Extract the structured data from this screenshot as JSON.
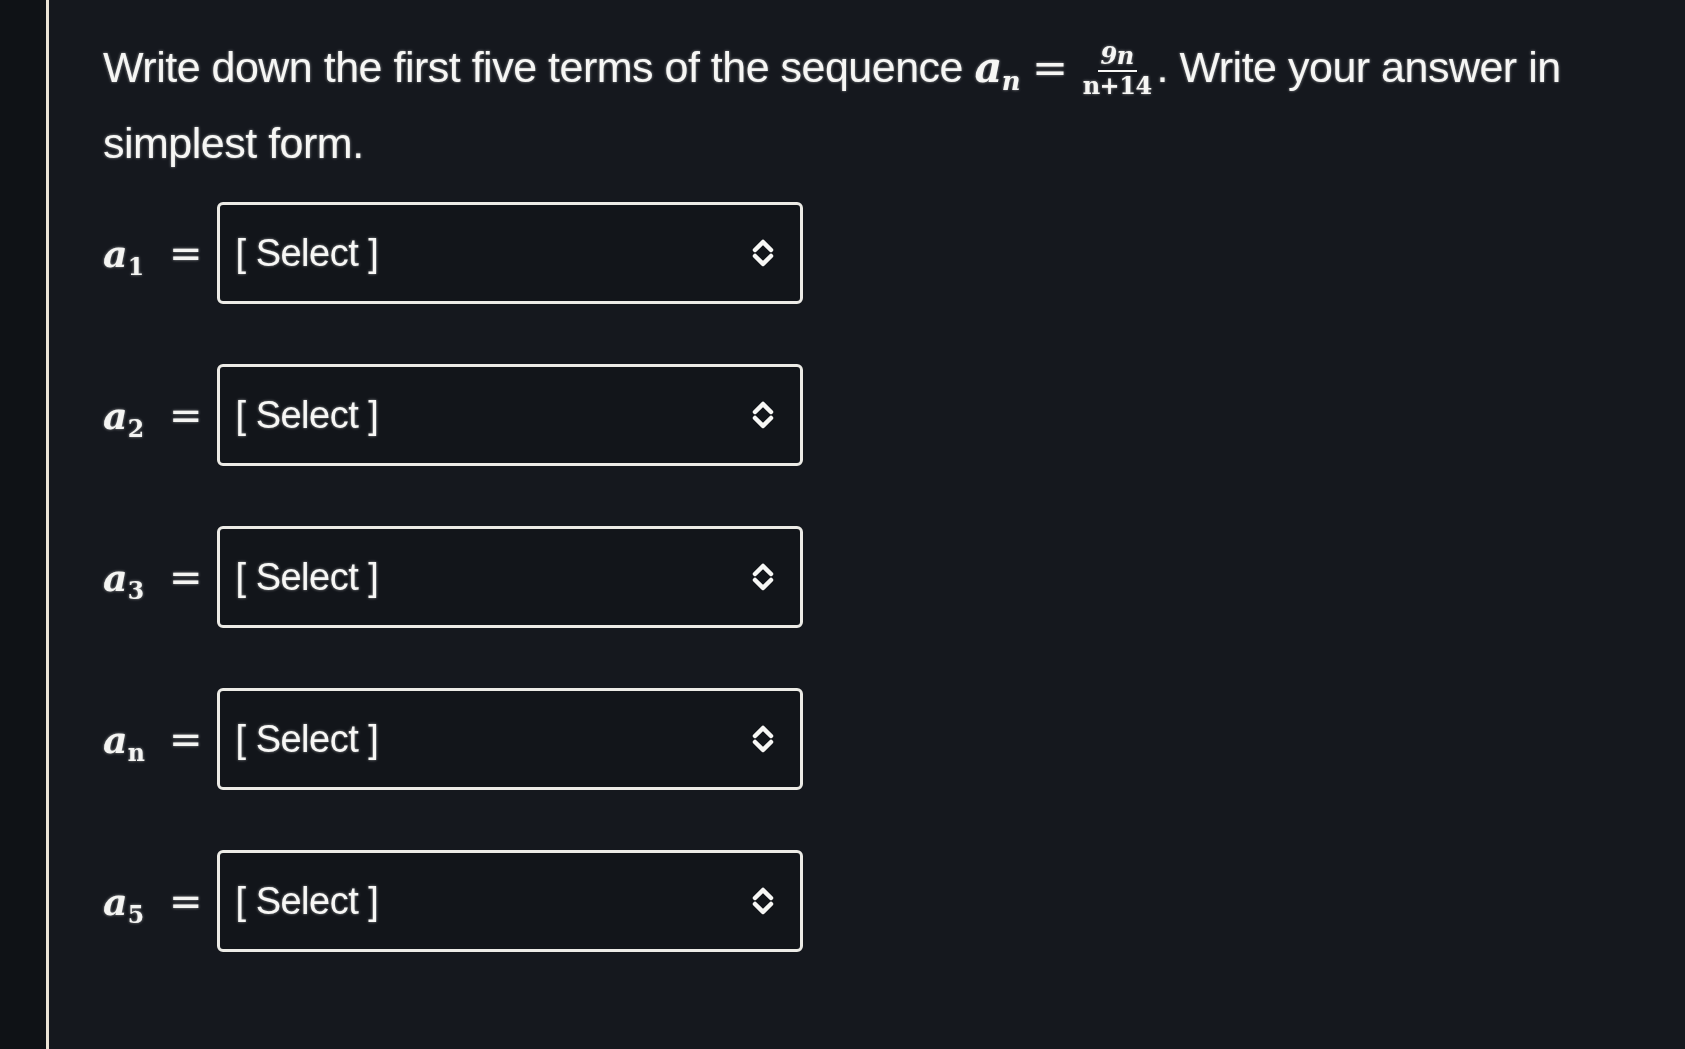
{
  "question": {
    "lead": "Write down the first five terms of the sequence",
    "term": "a$_{n}$",
    "relation": "=",
    "numerator": "9n",
    "denominator": "n+14",
    "tail": ". Write your answer in simplest form."
  },
  "answers": [
    {
      "label": "a$_{1}$",
      "relation": "=",
      "placeholder": "[ Select ]"
    },
    {
      "label": "a$_{2}$",
      "relation": "=",
      "placeholder": "[ Select ]"
    },
    {
      "label": "a$_{3}$",
      "relation": "=",
      "placeholder": "[ Select ]"
    },
    {
      "label": "a$_{n}$",
      "relation": "=",
      "placeholder": "[ Select ]"
    },
    {
      "label": "a$_{5}$",
      "relation": "=",
      "placeholder": "[ Select ]"
    }
  ]
}
